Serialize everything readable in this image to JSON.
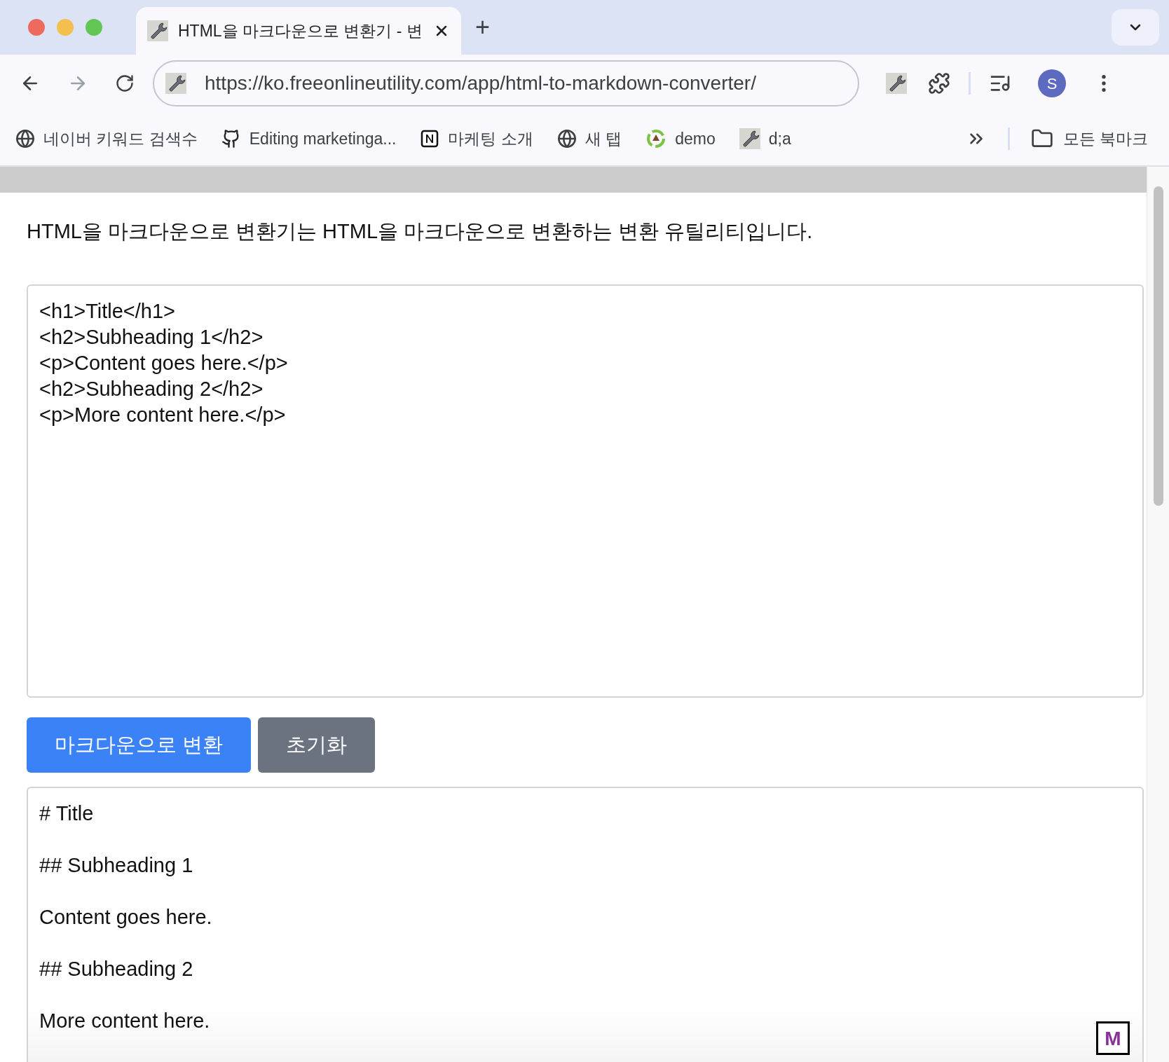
{
  "tabs": [
    {
      "title": "HTML을 마크다운으로 변환기 - 변",
      "selected": true
    }
  ],
  "new_tab": "+",
  "address_bar": {
    "url": "https://ko.freeonlineutility.com/app/html-to-markdown-converter/"
  },
  "profile": {
    "initial": "S"
  },
  "bookmarks": [
    {
      "kind": "globe",
      "label": "네이버 키워드 검색수"
    },
    {
      "kind": "github",
      "label": "Editing marketinga..."
    },
    {
      "kind": "notion",
      "label": "마케팅 소개"
    },
    {
      "kind": "globe",
      "label": "새 탭"
    },
    {
      "kind": "recycle",
      "label": "demo"
    },
    {
      "kind": "wrench",
      "label": "d;a"
    }
  ],
  "all_bookmarks": "모든 북마크",
  "page": {
    "description": "HTML을 마크다운으로 변환기는 HTML을 마크다운으로 변환하는 변환 유틸리티입니다.",
    "input": [
      "<h1>Title</h1>",
      "<h2>Subheading 1</h2>",
      "<p>Content goes here.</p>",
      "<h2>Subheading 2</h2>",
      "<p>More content here.</p>"
    ],
    "buttons": [
      {
        "label": "마크다운으로 변환",
        "kind": "primary"
      },
      {
        "label": "초기화",
        "kind": "secondary"
      }
    ],
    "output": [
      "# Title",
      "## Subheading 1",
      "Content goes here.",
      "## Subheading 2",
      "More content here."
    ],
    "badge": "M"
  }
}
